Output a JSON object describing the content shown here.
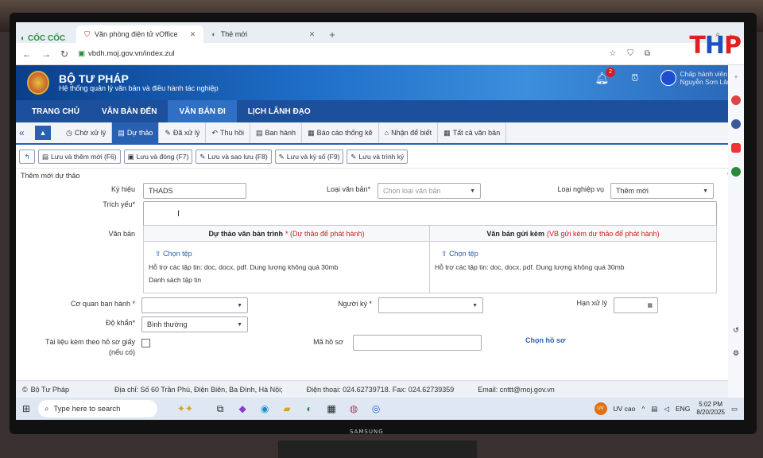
{
  "browser": {
    "brand": "CỐC CỐC",
    "tabs": [
      {
        "label": "Văn phòng điện tử vOffice"
      },
      {
        "label": "Thẻ mới"
      }
    ],
    "url": "vbdh.moj.gov.vn/index.zul"
  },
  "overlay_logo": {
    "text": "THP",
    "colors": [
      "#e02020",
      "#1a50c0",
      "#e02020"
    ]
  },
  "app": {
    "title": "BỘ TƯ PHÁP",
    "subtitle": "Hệ thống quản lý văn bản và điều hành tác nghiệp",
    "notif_count": "2",
    "user_role": "Chấp hành viên",
    "user_name": "Nguyễn Sơn Lâm"
  },
  "main_menu": [
    "TRANG CHỦ",
    "VĂN BẢN ĐẾN",
    "VĂN BẢN ĐI",
    "LỊCH LÃNH ĐẠO"
  ],
  "main_menu_selected": "VĂN BẢN ĐI",
  "sub_tabs": [
    "Chờ xử lý",
    "Dự thảo",
    "Đã xử lý",
    "Thu hồi",
    "Ban hành",
    "Báo cáo thống kê",
    "Nhận để biết",
    "Tất cả văn bản"
  ],
  "sub_tab_selected": "Dự thảo",
  "toolbar": [
    "Lưu và thêm mới (F6)",
    "Lưu và đóng (F7)",
    "Lưu và sao lưu (F8)",
    "Lưu và ký số (F9)",
    "Lưu và trình ký"
  ],
  "form": {
    "section_title": "Thêm mới dự thảo",
    "ky_hieu_label": "Ký hiệu",
    "ky_hieu_value": "THADS",
    "loai_vb_label": "Loại văn bản*",
    "loai_vb_placeholder": "Chọn loại văn bản",
    "loai_nv_label": "Loại nghiệp vụ",
    "loai_nv_value": "Thêm mới",
    "trich_yeu_label": "Trích yếu*",
    "van_ban_label": "Văn bản",
    "col1_title": "Dự thảo văn bản trình",
    "col1_note": "* (Dự thảo để phát hành)",
    "col2_title": "Văn bản gửi kèm",
    "col2_note": "(VB gửi kèm dự thảo để phát hành)",
    "choose_file": "Chọn tệp",
    "file_support": "Hỗ trợ các tập tin: doc, docx, pdf. Dung lượng không quá 30mb",
    "file_list": "Danh sách tập tin",
    "co_quan_label": "Cơ quan ban hành *",
    "nguoi_ky_label": "Người ký *",
    "han_xu_ly_label": "Hạn xử lý",
    "do_khan_label": "Độ khẩn*",
    "do_khan_value": "Bình thường",
    "tai_lieu_label": "Tài liệu kèm theo hồ sơ giấy",
    "tai_lieu_label2": "(nếu có)",
    "ma_ho_so_label": "Mã hồ sơ",
    "chon_ho_so": "Chọn hồ sơ"
  },
  "footer": {
    "brand": "Bộ Tư Pháp",
    "address": "Địa chỉ: Số 60 Trần Phú, Điện Biên, Ba Đình, Hà Nội;",
    "phone": "Điện thoại: 024.62739718. Fax: 024.62739359",
    "email": "Email: cnttt@moj.gov.vn"
  },
  "taskbar": {
    "search": "Type here to search",
    "uv": "UV cao",
    "lang": "ENG",
    "time": "5:02 PM",
    "date": "8/20/2025"
  },
  "monitor_brand": "SAMSUNG"
}
